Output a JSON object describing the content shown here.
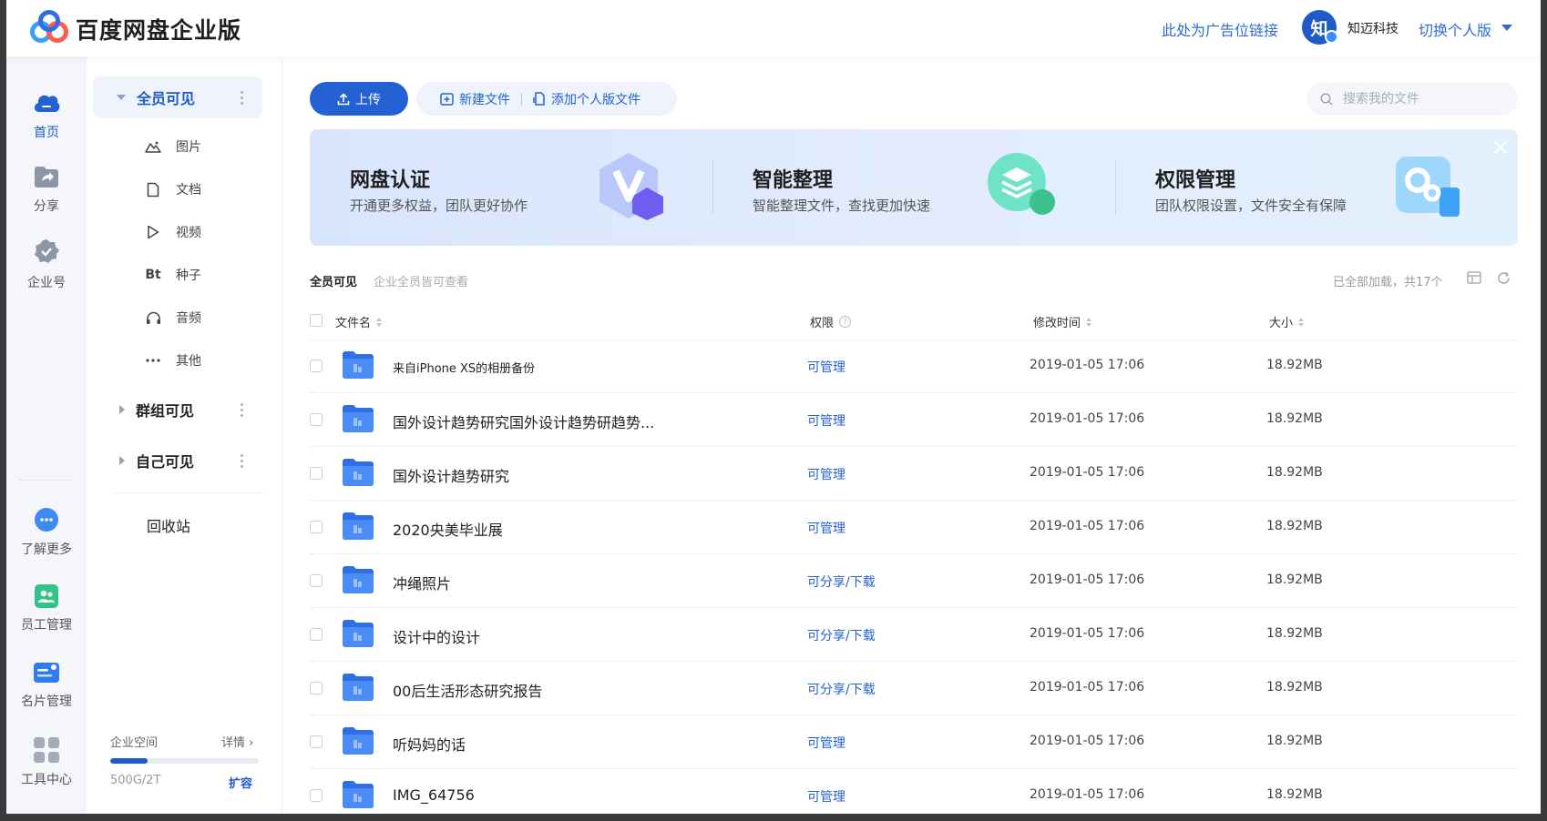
{
  "header": {
    "logo_text": "百度网盘企业版",
    "ad_link": "此处为广告位链接",
    "avatar_char": "知",
    "company_name": "知迈科技",
    "switch_edition": "切换个人版"
  },
  "rail": {
    "items": [
      {
        "label": "首页",
        "icon": "cloud-icon"
      },
      {
        "label": "分享",
        "icon": "share-icon"
      },
      {
        "label": "企业号",
        "icon": "enterprise-badge-icon"
      },
      {
        "label": "了解更多",
        "icon": "chat-bubble-icon"
      },
      {
        "label": "员工管理",
        "icon": "employees-icon"
      },
      {
        "label": "名片管理",
        "icon": "business-card-icon"
      },
      {
        "label": "工具中心",
        "icon": "tools-grid-icon"
      }
    ],
    "active_index": 0
  },
  "sidebar": {
    "sections": [
      {
        "label": "全员可见",
        "expanded": true
      },
      {
        "label": "群组可见",
        "expanded": false
      },
      {
        "label": "自己可见",
        "expanded": false
      }
    ],
    "categories": [
      {
        "label": "图片",
        "icon": "image-icon"
      },
      {
        "label": "文档",
        "icon": "document-icon"
      },
      {
        "label": "视频",
        "icon": "video-icon"
      },
      {
        "label": "种子",
        "icon": "torrent-icon",
        "glyph": "Bt"
      },
      {
        "label": "音频",
        "icon": "headphones-icon"
      },
      {
        "label": "其他",
        "icon": "more-icon"
      }
    ],
    "trash": "回收站",
    "storage": {
      "label": "企业空间",
      "detail": "详情",
      "usage": "500G/2T",
      "used_fraction": 0.25,
      "expand": "扩容"
    }
  },
  "toolbar": {
    "upload": "上传",
    "new_file": "新建文件",
    "add_personal": "添加个人版文件",
    "search_placeholder": "搜索我的文件"
  },
  "banner": {
    "promos": [
      {
        "title": "网盘认证",
        "desc": "开通更多权益，团队更好协作",
        "icon": "verify-v-icon"
      },
      {
        "title": "智能整理",
        "desc": "智能整理文件，查找更加快速",
        "icon": "layers-icon"
      },
      {
        "title": "权限管理",
        "desc": "团队权限设置，文件安全有保障",
        "icon": "gears-icon"
      }
    ]
  },
  "list": {
    "title": "全员可见",
    "subtitle": "企业全员皆可查看",
    "load_status": "已全部加载，共17个",
    "columns": {
      "name": "文件名",
      "perm": "权限",
      "mtime": "修改时间",
      "size": "大小"
    },
    "rows": [
      {
        "name": "来自iPhone XS的相册备份",
        "perm": "可管理",
        "mtime": "2019-01-05 17:06",
        "size": "18.92MB"
      },
      {
        "name": "国外设计趋势研究国外设计趋势研趋势...",
        "perm": "可管理",
        "mtime": "2019-01-05 17:06",
        "size": "18.92MB"
      },
      {
        "name": "国外设计趋势研究",
        "perm": "可管理",
        "mtime": "2019-01-05 17:06",
        "size": "18.92MB"
      },
      {
        "name": "2020央美毕业展",
        "perm": "可管理",
        "mtime": "2019-01-05 17:06",
        "size": "18.92MB"
      },
      {
        "name": "冲绳照片",
        "perm": "可分享/下载",
        "mtime": "2019-01-05 17:06",
        "size": "18.92MB"
      },
      {
        "name": "设计中的设计",
        "perm": "可分享/下载",
        "mtime": "2019-01-05 17:06",
        "size": "18.92MB"
      },
      {
        "name": "00后生活形态研究报告",
        "perm": "可分享/下载",
        "mtime": "2019-01-05 17:06",
        "size": "18.92MB"
      },
      {
        "name": "听妈妈的话",
        "perm": "可管理",
        "mtime": "2019-01-05 17:06",
        "size": "18.92MB"
      },
      {
        "name": "IMG_64756",
        "perm": "可管理",
        "mtime": "2019-01-05 17:06",
        "size": "18.92MB"
      }
    ]
  },
  "colors": {
    "accent": "#2462d3",
    "folder": "#3a7ff0",
    "rail_bg": "#f4f6fa"
  }
}
